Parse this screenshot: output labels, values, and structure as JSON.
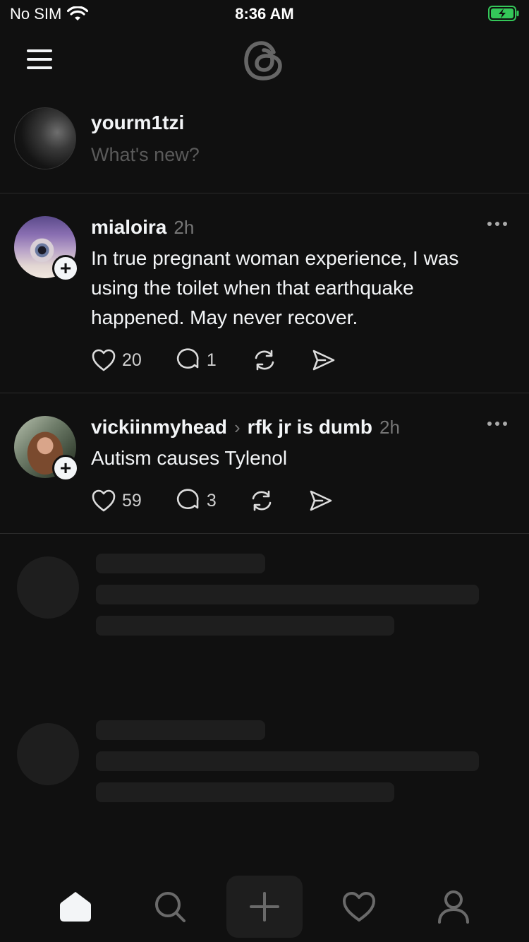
{
  "status": {
    "carrier": "No SIM",
    "time": "8:36 AM"
  },
  "composer": {
    "username": "yourm1tzi",
    "placeholder": "What's new?"
  },
  "posts": [
    {
      "username": "mialoira",
      "time": "2h",
      "text": "In true pregnant woman experience, I was using the toilet when that earthquake happened. May never recover.",
      "likes": "20",
      "replies": "1"
    },
    {
      "username": "vickiinmyhead",
      "topic": "rfk jr is dumb",
      "time": "2h",
      "text": "Autism causes Tylenol",
      "likes": "59",
      "replies": "3"
    }
  ],
  "icons": [
    "menu-icon",
    "threads-logo-icon",
    "heart-icon",
    "comment-icon",
    "repost-icon",
    "share-icon",
    "more-icon",
    "home-icon",
    "search-icon",
    "plus-icon",
    "profile-icon"
  ],
  "colors": {
    "background": "#101010",
    "text": "#f3f5f7",
    "muted": "#777777",
    "skeleton": "#1e1e1e",
    "battery": "#34c759"
  }
}
